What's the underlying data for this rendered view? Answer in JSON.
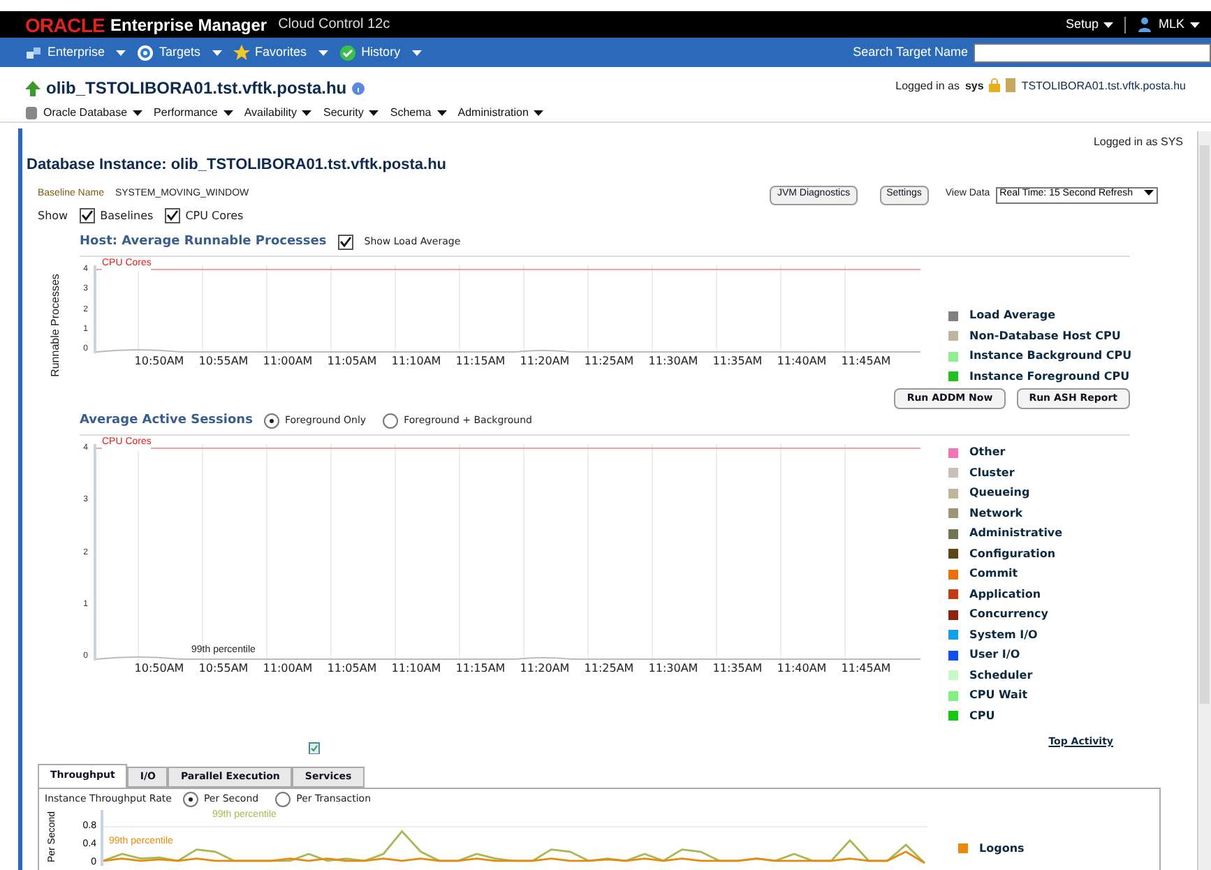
{
  "header": {
    "brand": "ORACLE",
    "product": "Enterprise Manager",
    "edition": "Cloud Control 12c",
    "setup": "Setup",
    "user": "MLK"
  },
  "nav": {
    "items": [
      {
        "label": "Enterprise",
        "kind": "enterprise"
      },
      {
        "label": "Targets",
        "kind": "target"
      },
      {
        "label": "Favorites",
        "kind": "star"
      },
      {
        "label": "History",
        "kind": "history"
      }
    ],
    "search_label": "Search Target Name"
  },
  "target": {
    "title": "olib_TSTOLIBORA01.tst.vftk.posta.hu",
    "menus": [
      "Oracle Database",
      "Performance",
      "Availability",
      "Security",
      "Schema",
      "Administration"
    ],
    "logged_in": "Logged in as",
    "user": "sys",
    "host": "TSTOLIBORA01.tst.vftk.posta.hu"
  },
  "page": {
    "logged_in": "Logged in as SYS",
    "title": "Database Instance: olib_TSTOLIBORA01.tst.vftk.posta.hu",
    "baseline_label": "Baseline Name",
    "baseline_value": "SYSTEM_MOVING_WINDOW",
    "buttons": [
      "JVM Diagnostics",
      "Settings"
    ],
    "view_data_label": "View Data",
    "view_data_value": "Real Time: 15 Second Refresh",
    "show_label": "Show",
    "show_options": [
      {
        "label": "Baselines",
        "checked": true
      },
      {
        "label": "CPU Cores",
        "checked": true
      }
    ]
  },
  "host_chart": {
    "title": "Host: Average Runnable Processes",
    "option": {
      "label": "Show Load Average",
      "checked": true
    },
    "ylabel": "Runnable Processes",
    "limit_label": "CPU Cores",
    "yticks": [
      "4",
      "3",
      "2",
      "1",
      "0"
    ],
    "xticks": [
      "10:50AM",
      "10:55AM",
      "11:00AM",
      "11:05AM",
      "11:10AM",
      "11:15AM",
      "11:20AM",
      "11:25AM",
      "11:30AM",
      "11:35AM",
      "11:40AM",
      "11:45AM"
    ],
    "legend": [
      {
        "label": "Load Average",
        "color": "#808080"
      },
      {
        "label": "Non-Database Host CPU",
        "color": "#c0b49c"
      },
      {
        "label": "Instance Background CPU",
        "color": "#90ee90"
      },
      {
        "label": "Instance Foreground CPU",
        "color": "#22c022"
      }
    ]
  },
  "sessions": {
    "buttons": [
      "Run ADDM Now",
      "Run ASH Report"
    ],
    "title": "Average Active Sessions",
    "radios": [
      {
        "label": "Foreground Only",
        "selected": true
      },
      {
        "label": "Foreground + Background",
        "selected": false
      }
    ],
    "limit_label": "CPU Cores",
    "percentile_label": "99th percentile",
    "yticks": [
      "4",
      "3",
      "2",
      "1",
      "0"
    ],
    "xticks": [
      "10:50AM",
      "10:55AM",
      "11:00AM",
      "11:05AM",
      "11:10AM",
      "11:15AM",
      "11:20AM",
      "11:25AM",
      "11:30AM",
      "11:35AM",
      "11:40AM",
      "11:45AM"
    ],
    "legend": [
      {
        "label": "Other",
        "color": "#f075b4"
      },
      {
        "label": "Cluster",
        "color": "#c8c0b4"
      },
      {
        "label": "Queueing",
        "color": "#c0b49c"
      },
      {
        "label": "Network",
        "color": "#a09478"
      },
      {
        "label": "Administrative",
        "color": "#747454"
      },
      {
        "label": "Configuration",
        "color": "#5c4814"
      },
      {
        "label": "Commit",
        "color": "#e8700c"
      },
      {
        "label": "Application",
        "color": "#c03c14"
      },
      {
        "label": "Concurrency",
        "color": "#8c2410"
      },
      {
        "label": "System I/O",
        "color": "#14a0e8"
      },
      {
        "label": "User I/O",
        "color": "#0c54e8"
      },
      {
        "label": "Scheduler",
        "color": "#c8f8c8"
      },
      {
        "label": "CPU Wait",
        "color": "#80f080"
      },
      {
        "label": "CPU",
        "color": "#14c814"
      }
    ],
    "link": "Top Activity"
  },
  "tabs": [
    {
      "label": "Throughput",
      "selected": true
    },
    {
      "label": "I/O",
      "selected": false
    },
    {
      "label": "Parallel Execution",
      "selected": false
    },
    {
      "label": "Services",
      "selected": false
    }
  ],
  "throughput": {
    "label": "Instance Throughput Rate",
    "radios": [
      {
        "label": "Per Second",
        "selected": true
      },
      {
        "label": "Per Transaction",
        "selected": false
      }
    ],
    "percentile_labels": [
      "99th percentile",
      "99th percentile"
    ],
    "chart_data": {
      "type": "line",
      "ylabel": "Per Second",
      "ylim": [
        0,
        0.8
      ],
      "yticks": [
        {
          "value": 0.8,
          "label": "0.8"
        },
        {
          "value": 0.4,
          "label": "0.4"
        },
        {
          "value": 0,
          "label": "0"
        }
      ],
      "series": [
        {
          "color": "#a8b850",
          "values": [
            0.05,
            0.2,
            0.1,
            0.12,
            0.05,
            0.3,
            0.25,
            0.05,
            0.05,
            0.05,
            0.05,
            0.2,
            0.05,
            0.1,
            0.05,
            0.2,
            0.7,
            0.25,
            0.05,
            0.05,
            0.2,
            0.1,
            0.05,
            0.05,
            0.3,
            0.25,
            0.05,
            0.1,
            0.05,
            0.2,
            0.05,
            0.3,
            0.25,
            0.05,
            0.05,
            0.1,
            0.05,
            0.2,
            0.05,
            0.05,
            0.5,
            0.05,
            0.05,
            0.4,
            0
          ]
        },
        {
          "name": "Logons",
          "color": "#e8880c",
          "values": [
            0.05,
            0.1,
            0.05,
            0.08,
            0.05,
            0.1,
            0.05,
            0.05,
            0.05,
            0.05,
            0.1,
            0.05,
            0.1,
            0.05,
            0.05,
            0.1,
            0.05,
            0.1,
            0.05,
            0.05,
            0.1,
            0.05,
            0.05,
            0.05,
            0.1,
            0.05,
            0.05,
            0.08,
            0.05,
            0.1,
            0.05,
            0.1,
            0.05,
            0.05,
            0.05,
            0.1,
            0.05,
            0.05,
            0.05,
            0.05,
            0.1,
            0.05,
            0.05,
            0.25,
            0
          ]
        }
      ]
    }
  }
}
